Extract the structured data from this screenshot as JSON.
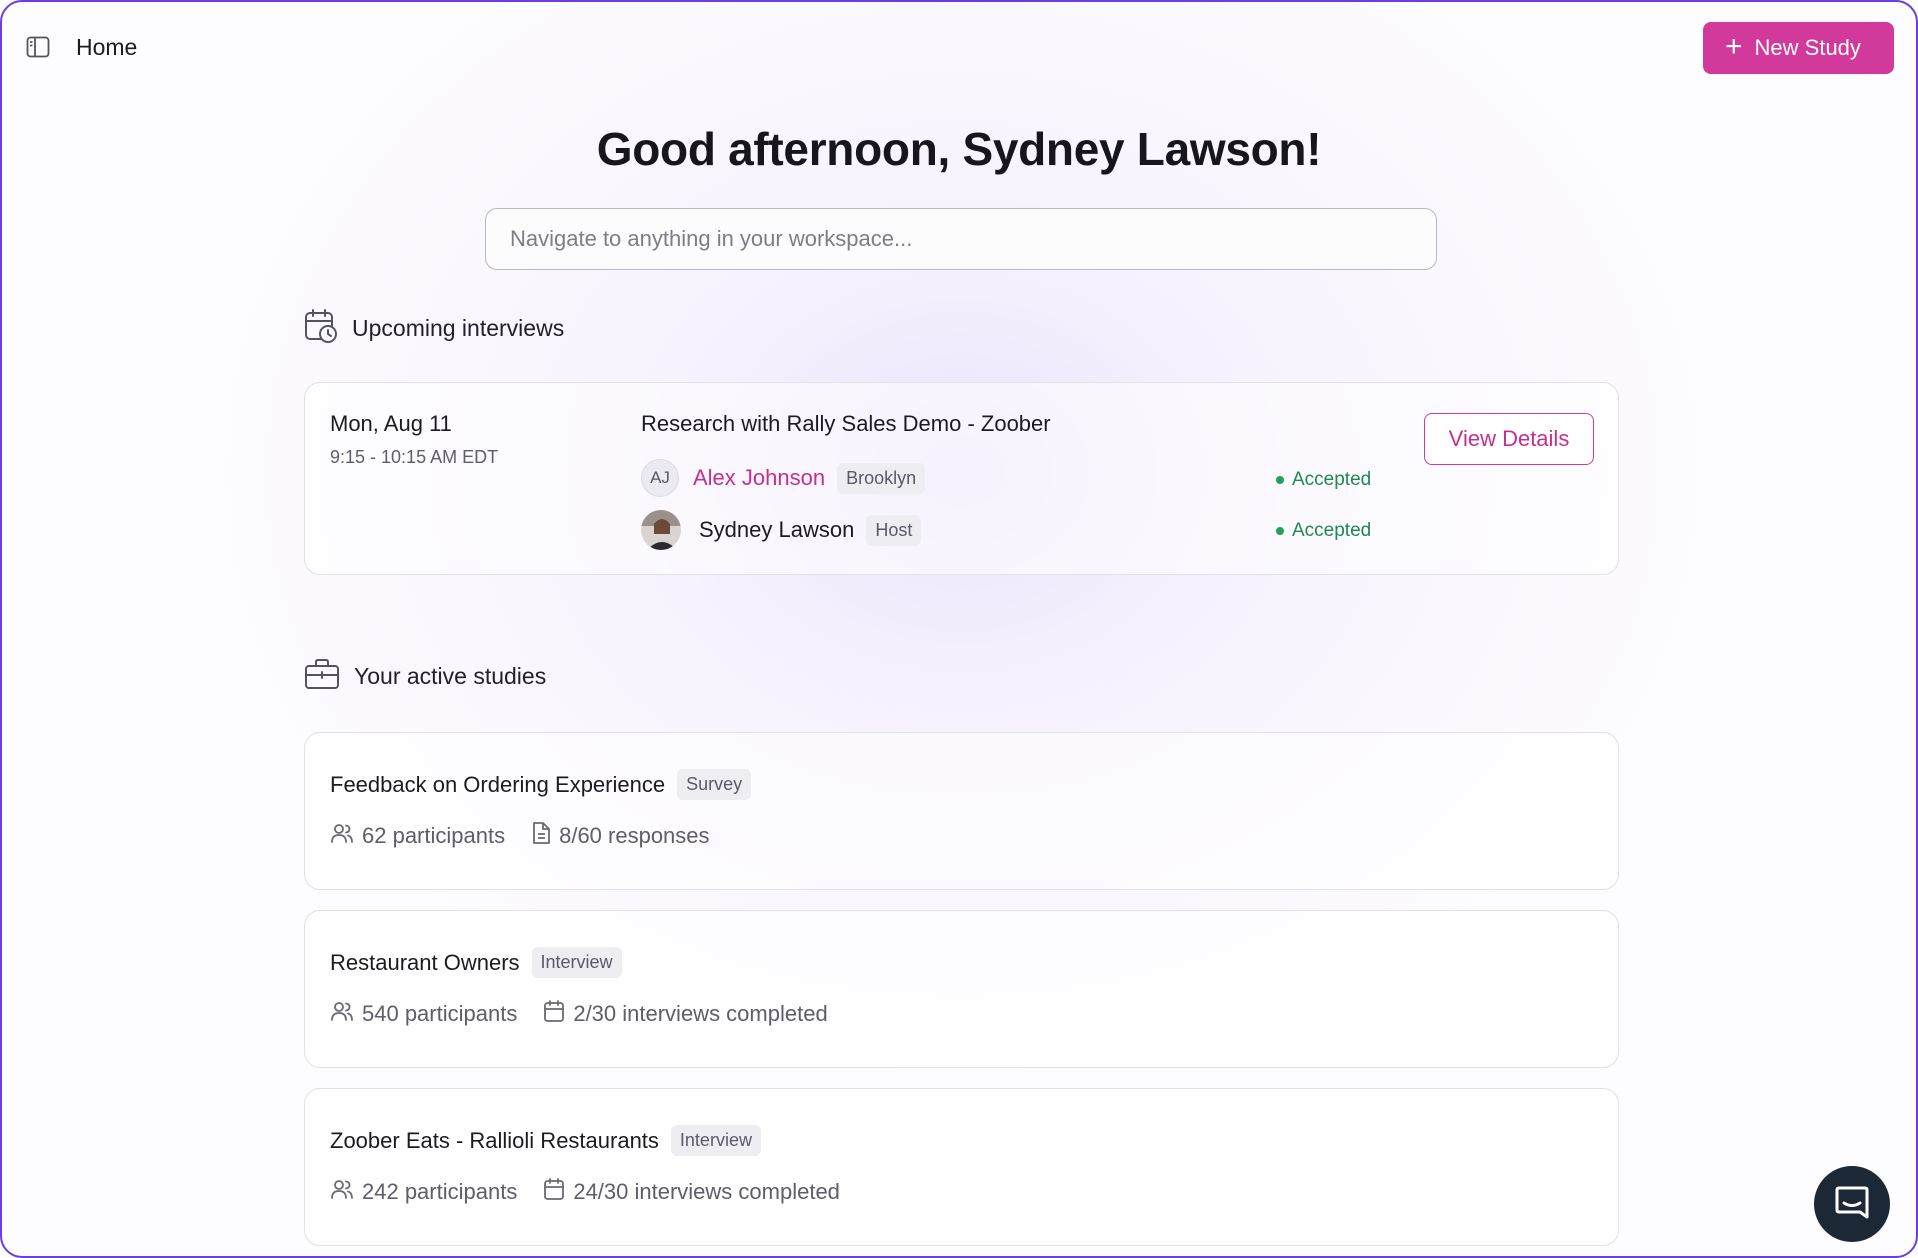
{
  "topbar": {
    "page_label": "Home",
    "new_study_label": "New Study"
  },
  "greeting": "Good afternoon, Sydney Lawson!",
  "search": {
    "placeholder": "Navigate to anything in your workspace..."
  },
  "upcoming": {
    "section_title": "Upcoming interviews",
    "interview": {
      "date": "Mon, Aug 11",
      "time": "9:15 - 10:15 AM EDT",
      "title": "Research with Rally Sales Demo - Zoober",
      "view_details_label": "View Details",
      "participants": [
        {
          "initials": "AJ",
          "name": "Alex Johnson",
          "tag": "Brooklyn",
          "status": "Accepted"
        },
        {
          "initials": "",
          "name": "Sydney Lawson",
          "tag": "Host",
          "status": "Accepted"
        }
      ]
    }
  },
  "active_studies": {
    "section_title": "Your active studies",
    "studies": [
      {
        "title": "Feedback on Ordering Experience",
        "type": "Survey",
        "participants": "62 participants",
        "progress": "8/60 responses",
        "progress_icon": "document-icon"
      },
      {
        "title": "Restaurant Owners",
        "type": "Interview",
        "participants": "540 participants",
        "progress": "2/30 interviews completed",
        "progress_icon": "calendar-icon"
      },
      {
        "title": "Zoober Eats - Rallioli Restaurants",
        "type": "Interview",
        "participants": "242 participants",
        "progress": "24/30 interviews completed",
        "progress_icon": "calendar-icon"
      }
    ]
  },
  "colors": {
    "accent": "#d1399b",
    "frame_border": "#6a3ee0",
    "accepted": "#1d8a4f",
    "chat_bubble": "#1d2837"
  }
}
